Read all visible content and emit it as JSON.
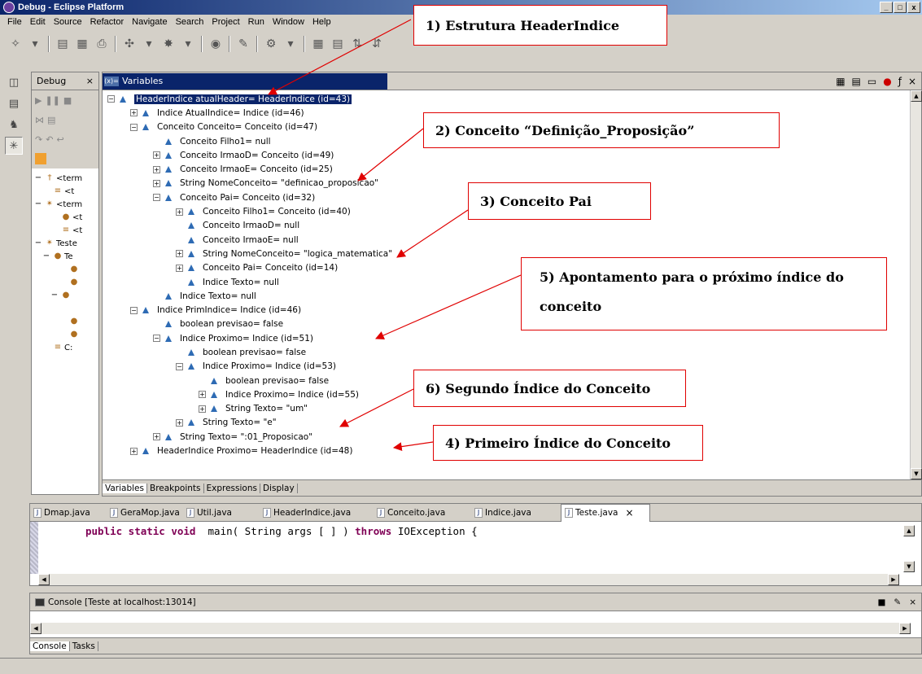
{
  "window": {
    "title": "Debug - Eclipse Platform",
    "buttons": [
      "_",
      "□",
      "x"
    ]
  },
  "menu": [
    "File",
    "Edit",
    "Source",
    "Refactor",
    "Navigate",
    "Search",
    "Project",
    "Run",
    "Window",
    "Help"
  ],
  "debug_view": {
    "tab_label": "Debug",
    "close": "×"
  },
  "debug_tree": [
    {
      "indent": 0,
      "expander": "−",
      "icon": "†",
      "label": "<term"
    },
    {
      "indent": 1,
      "expander": "",
      "icon": "≡",
      "label": "<t"
    },
    {
      "indent": 0,
      "expander": "−",
      "icon": "✴",
      "label": "<term"
    },
    {
      "indent": 2,
      "expander": "",
      "icon": "●",
      "label": "<t"
    },
    {
      "indent": 2,
      "expander": "",
      "icon": "≡",
      "label": "<t"
    },
    {
      "indent": 0,
      "expander": "−",
      "icon": "✴",
      "label": "Teste"
    },
    {
      "indent": 1,
      "expander": "−",
      "icon": "●",
      "label": "Te"
    },
    {
      "indent": 3,
      "expander": "",
      "icon": "●",
      "label": ""
    },
    {
      "indent": 3,
      "expander": "",
      "icon": "●",
      "label": ""
    },
    {
      "indent": 2,
      "expander": "−",
      "icon": "●",
      "label": ""
    },
    {
      "indent": 3,
      "expander": "",
      "icon": "",
      "label": ""
    },
    {
      "indent": 3,
      "expander": "",
      "icon": "●",
      "label": ""
    },
    {
      "indent": 3,
      "expander": "",
      "icon": "●",
      "label": ""
    },
    {
      "indent": 1,
      "expander": "",
      "icon": "≡",
      "label": "C:"
    }
  ],
  "variables_view": {
    "tab_label": "Variables",
    "tab_icon": "(x)=",
    "close": "×",
    "rows": [
      {
        "indent": 0,
        "expander": "−",
        "label": "HeaderIndice atualHeader= HeaderIndice  (id=43)",
        "selected": true
      },
      {
        "indent": 1,
        "expander": "+",
        "label": "Indice AtualIndice= Indice  (id=46)"
      },
      {
        "indent": 1,
        "expander": "−",
        "label": "Conceito Conceito= Conceito  (id=47)"
      },
      {
        "indent": 2,
        "expander": "",
        "label": "Conceito Filho1= null"
      },
      {
        "indent": 2,
        "expander": "+",
        "label": "Conceito IrmaoD= Conceito  (id=49)"
      },
      {
        "indent": 2,
        "expander": "+",
        "label": "Conceito IrmaoE= Conceito  (id=25)"
      },
      {
        "indent": 2,
        "expander": "+",
        "label": "String NomeConceito= \"definicao_proposicao\""
      },
      {
        "indent": 2,
        "expander": "−",
        "label": "Conceito Pai= Conceito  (id=32)"
      },
      {
        "indent": 3,
        "expander": "+",
        "label": "Conceito Filho1= Conceito  (id=40)"
      },
      {
        "indent": 3,
        "expander": "",
        "label": "Conceito IrmaoD= null"
      },
      {
        "indent": 3,
        "expander": "",
        "label": "Conceito IrmaoE= null"
      },
      {
        "indent": 3,
        "expander": "+",
        "label": "String NomeConceito= \"logica_matematica\""
      },
      {
        "indent": 3,
        "expander": "+",
        "label": "Conceito Pai= Conceito  (id=14)"
      },
      {
        "indent": 3,
        "expander": "",
        "label": "Indice Texto= null"
      },
      {
        "indent": 2,
        "expander": "",
        "label": "Indice Texto= null"
      },
      {
        "indent": 1,
        "expander": "−",
        "label": "Indice PrimIndice= Indice  (id=46)"
      },
      {
        "indent": 2,
        "expander": "",
        "label": "boolean previsao= false"
      },
      {
        "indent": 2,
        "expander": "−",
        "label": "Indice Proximo= Indice  (id=51)"
      },
      {
        "indent": 3,
        "expander": "",
        "label": "boolean previsao= false"
      },
      {
        "indent": 3,
        "expander": "−",
        "label": "Indice Proximo= Indice  (id=53)"
      },
      {
        "indent": 4,
        "expander": "",
        "label": "boolean previsao= false"
      },
      {
        "indent": 4,
        "expander": "+",
        "label": "Indice Proximo= Indice  (id=55)"
      },
      {
        "indent": 4,
        "expander": "+",
        "label": "String Texto= \"um\""
      },
      {
        "indent": 3,
        "expander": "+",
        "label": "String Texto= \"e\""
      },
      {
        "indent": 2,
        "expander": "+",
        "label": "String Texto= \":01_Proposicao\""
      },
      {
        "indent": 1,
        "expander": "+",
        "label": "HeaderIndice Proximo= HeaderIndice  (id=48)"
      }
    ],
    "bottom_tabs": [
      "Variables",
      "Breakpoints",
      "Expressions",
      "Display"
    ]
  },
  "editor": {
    "tabs": [
      "Dmap.java",
      "GeraMop.java",
      "Util.java",
      "HeaderIndice.java",
      "Conceito.java",
      "Indice.java",
      "Teste.java"
    ],
    "active_tab": "Teste.java",
    "close": "×",
    "code_kw1": "public static void",
    "code_mid": "  main( String args [ ] ) ",
    "code_kw2": "throws",
    "code_end": " IOException {"
  },
  "console": {
    "title": "Console [Teste at localhost:13014]",
    "close": "×",
    "tabs": [
      "Console",
      "Tasks"
    ]
  },
  "callouts": [
    {
      "id": "1",
      "text": "1) Estrutura HeaderIndice"
    },
    {
      "id": "2",
      "text": "2) Conceito “Definição_Proposição”"
    },
    {
      "id": "3",
      "text": "3) Conceito Pai"
    },
    {
      "id": "5",
      "line1": "5) Apontamento para o próximo índice do",
      "line2": "conceito"
    },
    {
      "id": "6",
      "text": "6) Segundo Índice do Conceito"
    },
    {
      "id": "4",
      "text": "4) Primeiro Índice do Conceito"
    }
  ],
  "colors": {
    "selection": "#0a246a",
    "callout_border": "#e00000",
    "arrow": "#e00000",
    "node_icon": "#2e6bb4",
    "keyword": "#7f0055"
  }
}
